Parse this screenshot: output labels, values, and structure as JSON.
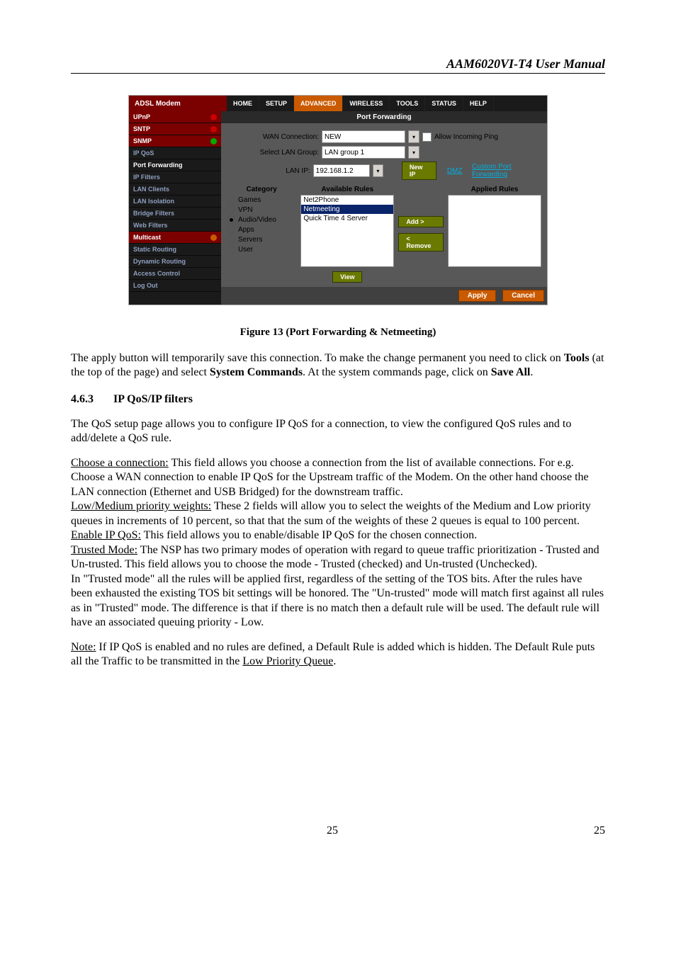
{
  "doc": {
    "header": "AAM6020VI-T4 User Manual",
    "figure_caption": "Figure 13 (Port Forwarding & Netmeeting)",
    "para1_a": "The apply button will temporarily save this connection. To make the change permanent you need to click on ",
    "para1_b": "Tools",
    "para1_c": " (at the top of the page) and select ",
    "para1_d": "System Commands",
    "para1_e": ".  At the system commands page, click on ",
    "para1_f": "Save All",
    "para1_g": ".",
    "section_num": "4.6.3",
    "section_title": "IP QoS/IP filters",
    "para2": "The QoS setup page allows you to configure IP QoS for a connection, to view the configured QoS rules and to add/delete a QoS rule.",
    "choose_u": "Choose a connection:",
    "choose_rest": " This field allows you choose a connection from the list of available connections. For e.g. Choose a WAN connection to enable IP QoS for the Upstream traffic of the Modem. On the other hand choose the LAN connection (Ethernet and USB Bridged) for the downstream traffic.",
    "lowmed_u": "Low/Medium priority weights:",
    "lowmed_rest": " These 2 fields will allow you to select the weights of the Medium and Low priority queues in increments of 10 percent, so that that the sum of the weights of these 2 queues is equal to 100 percent.",
    "enable_u": "Enable IP QoS:",
    "enable_rest": " This field allows you to enable/disable IP QoS for the chosen connection.",
    "trusted_u": "Trusted Mode:",
    "trusted_rest": " The NSP has two primary modes of operation with regard to queue traffic prioritization - Trusted and Un-trusted. This field allows you to choose the mode - Trusted (checked) and Un-trusted (Unchecked).",
    "trusted_para2": "In \"Trusted mode\" all the rules will be applied first, regardless of the setting of the TOS bits. After the rules have been exhausted the existing TOS bit settings will be honored. The \"Un-trusted\" mode will match first against all rules as in \"Trusted\" mode. The difference is that if there is no match then a default rule will be used. The default rule will have an associated queuing priority - Low.",
    "note_u": "Note:",
    "note_mid": " If IP QoS is enabled and no rules are defined, a Default Rule is added which is hidden. The Default Rule puts all the Traffic to be transmitted in the ",
    "note_u2": "Low Priority Queue",
    "note_end": ".",
    "page_left": "25",
    "page_right": "25"
  },
  "ss": {
    "brand": "ADSL Modem",
    "tabs": [
      "HOME",
      "SETUP",
      "ADVANCED",
      "WIRELESS",
      "TOOLS",
      "STATUS",
      "HELP"
    ],
    "sidebar": [
      {
        "label": "UPnP",
        "dot": "red"
      },
      {
        "label": "SNTP",
        "dot": "red"
      },
      {
        "label": "SNMP",
        "dot": "green"
      },
      {
        "label": "IP QoS",
        "dot": ""
      },
      {
        "label": "Port Forwarding",
        "dot": ""
      },
      {
        "label": "IP Filters",
        "dot": ""
      },
      {
        "label": "LAN Clients",
        "dot": ""
      },
      {
        "label": "LAN Isolation",
        "dot": ""
      },
      {
        "label": "Bridge Filters",
        "dot": ""
      },
      {
        "label": "Web Filters",
        "dot": ""
      },
      {
        "label": "Multicast",
        "dot": "orange"
      },
      {
        "label": "Static Routing",
        "dot": ""
      },
      {
        "label": "Dynamic Routing",
        "dot": ""
      },
      {
        "label": "Access Control",
        "dot": ""
      },
      {
        "label": "Log Out",
        "dot": ""
      }
    ],
    "panel_title": "Port Forwarding",
    "wan_label": "WAN Connection:",
    "wan_value": "NEW",
    "allow_ping": "Allow Incoming Ping",
    "lan_group_label": "Select LAN Group:",
    "lan_group_value": "LAN group 1",
    "lan_ip_label": "LAN IP:",
    "lan_ip_value": "192.168.1.2",
    "new_ip_btn": "New IP",
    "dmz_link": "DMZ",
    "custom_link": "Custom Port Forwarding",
    "category_head": "Category",
    "available_head": "Available Rules",
    "applied_head": "Applied Rules",
    "categories": [
      "Games",
      "VPN",
      "Audio/Video",
      "Apps",
      "Servers",
      "User"
    ],
    "selected_category_index": 2,
    "rules": [
      "Net2Phone",
      "Netmeeting",
      "Quick Time 4 Server"
    ],
    "selected_rule_index": 1,
    "add_btn": "Add >",
    "remove_btn": "< Remove",
    "view_btn": "View",
    "apply_btn": "Apply",
    "cancel_btn": "Cancel"
  }
}
